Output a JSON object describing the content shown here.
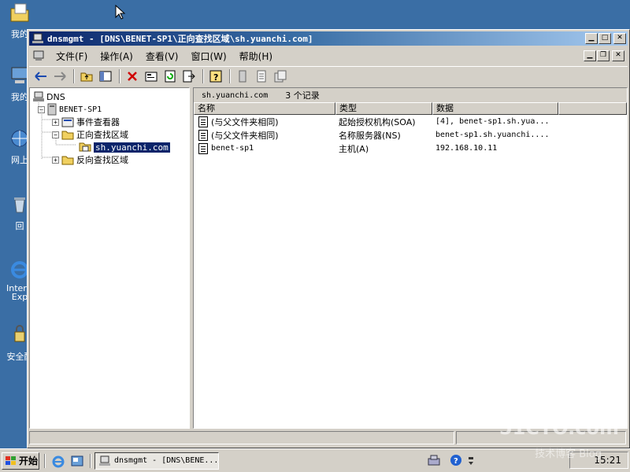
{
  "desktop": {
    "icons": [
      {
        "label": "我的",
        "icon": "documents-icon"
      },
      {
        "label": "我的",
        "icon": "computer-icon"
      },
      {
        "label": "网上",
        "icon": "network-icon"
      },
      {
        "label": "回",
        "icon": "recycle-bin-icon"
      },
      {
        "label": "Internet Exp",
        "icon": "ie-icon"
      },
      {
        "label": "安全配",
        "icon": "security-icon"
      }
    ]
  },
  "window": {
    "title": "dnsmgmt - [DNS\\BENET-SP1\\正向查找区域\\sh.yuanchi.com]",
    "menu": [
      "文件(F)",
      "操作(A)",
      "查看(V)",
      "窗口(W)",
      "帮助(H)"
    ]
  },
  "tree": {
    "root": "DNS",
    "server": "BENET-SP1",
    "items": [
      "事件查看器",
      "正向查找区域",
      "sh.yuanchi.com",
      "反向查找区域"
    ]
  },
  "list": {
    "zone": "sh.yuanchi.com",
    "count": "3 个记录",
    "columns": [
      "名称",
      "类型",
      "数据"
    ],
    "rows": [
      {
        "name": "(与父文件夹相同)",
        "type": "起始授权机构(SOA)",
        "data": "[4], benet-sp1.sh.yua..."
      },
      {
        "name": "(与父文件夹相同)",
        "type": "名称服务器(NS)",
        "data": "benet-sp1.sh.yuanchi...."
      },
      {
        "name": "benet-sp1",
        "type": "主机(A)",
        "data": "192.168.10.11"
      }
    ]
  },
  "taskbar": {
    "start": "开始",
    "task": "dnsmgmt - [DNS\\BENE...",
    "clock": "15:21"
  },
  "watermark": {
    "text": "51CTO.com",
    "sub": "技术博客 Blog"
  },
  "colors": {
    "desktop": "#3a6ea5",
    "title_active": "#0a246a",
    "face": "#d4d0c8"
  }
}
